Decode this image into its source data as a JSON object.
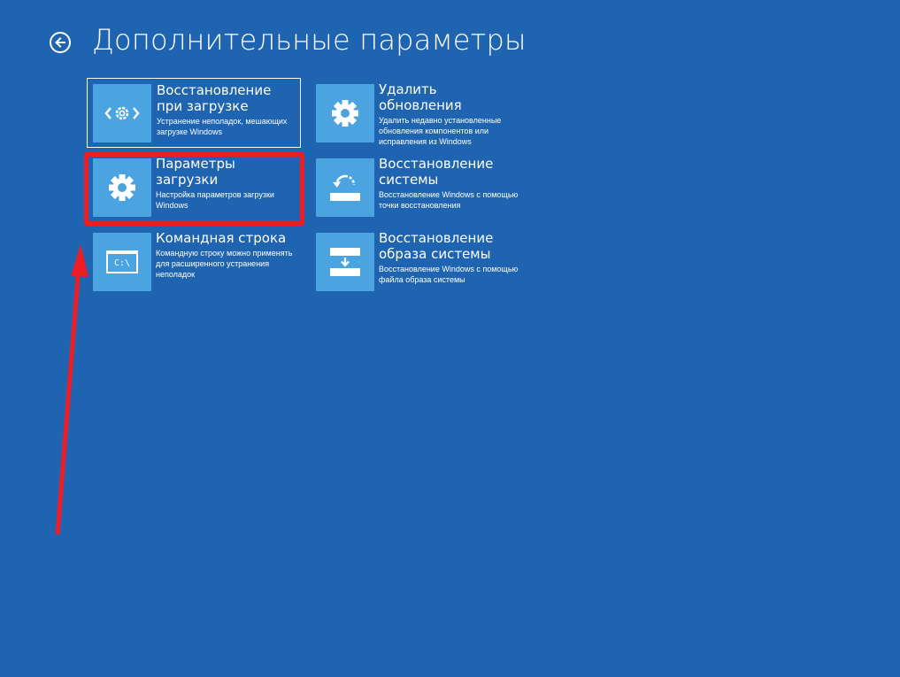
{
  "header": {
    "title": "Дополнительные параметры"
  },
  "tiles": [
    {
      "title": "Восстановление при загрузке",
      "desc": "Устранение неполадок, мешающих загрузке Windows",
      "icon": "startup-repair-icon"
    },
    {
      "title": "Удалить обновления",
      "desc": "Удалить недавно установленные обновления компонентов или исправления из Windows",
      "icon": "gear-icon"
    },
    {
      "title": "Параметры загрузки",
      "desc": "Настройка параметров загрузки Windows",
      "icon": "gear-icon"
    },
    {
      "title": "Восстановление системы",
      "desc": "Восстановление Windows с помощью точки восстановления",
      "icon": "system-restore-icon"
    },
    {
      "title": "Командная строка",
      "desc": "Командную строку можно применять для расширенного устранения неполадок",
      "icon": "command-prompt-icon",
      "icon_text": "C:\\"
    },
    {
      "title": "Восстановление образа системы",
      "desc": "Восстановление Windows с помощью файла образа системы",
      "icon": "system-image-icon"
    }
  ],
  "colors": {
    "background": "#1f64b1",
    "tile_icon": "#4ba3df",
    "annotation": "#ee1c25"
  },
  "annotations": {
    "highlighted_tile": "Параметры загрузки"
  }
}
